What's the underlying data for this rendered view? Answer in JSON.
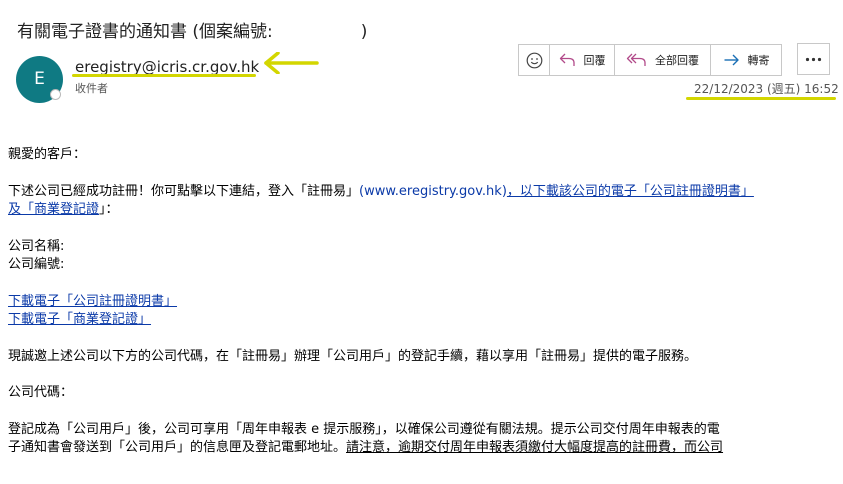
{
  "subject": {
    "text": "有關電子證書的通知書 (個案編號:",
    "close": ")"
  },
  "sender": {
    "avatar_letter": "E",
    "email": "eregistry@icris.cr.gov.hk",
    "recipient_label": "收件者"
  },
  "toolbar": {
    "emoji_icon": "smiley-icon",
    "reply_label": "回覆",
    "reply_all_label": "全部回覆",
    "forward_label": "轉寄",
    "more_icon": "ellipsis-icon"
  },
  "timestamp": "22/12/2023 (週五) 16:52",
  "colors": {
    "avatar": "#0f7a83",
    "annotation": "#d3d600",
    "link": "#0b3aa8",
    "reply_icon": "#b24a8a",
    "forward_icon": "#1a6fb5"
  },
  "body": {
    "greeting": "親愛的客戶：",
    "intro_text": "下述公司已經成功註冊！你可點擊以下連結，登入「註冊易」",
    "intro_link_url": "(www.eregistry.gov.hk)",
    "intro_link_rest": "，以下載該公司的電子「公司註冊證明書」",
    "intro_line2_link": "及「商業登記證",
    "intro_line2_tail": "」：",
    "company_name_label": "公司名稱:",
    "company_number_label": "公司編號:",
    "download_cert_link": "下載電子「公司註冊證明書」",
    "download_br_link": "下載電子「商業登記證」",
    "invite_text": "現誠邀上述公司以下方的公司代碼，在「註冊易」辦理「公司用戶」的登記手續，藉以享用「註冊易」提供的電子服務。",
    "company_code_label": "公司代碼：",
    "para_line1": "登記成為「公司用戶」後，公司可享用「周年申報表 e 提示服務」，以確保公司遵從有關法規。提示公司交付周年申報表的電",
    "para_line2_plain": "子通知書會發送到「公司用戶」的信息匣及登記電郵地址。",
    "para_line2_underlined": "請注意，逾期交付周年申報表須繳付大幅度提高的註冊費，而公司"
  }
}
